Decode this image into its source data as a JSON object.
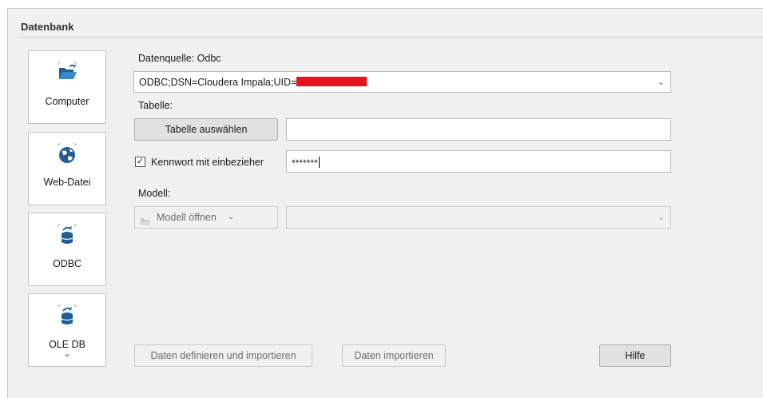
{
  "section": {
    "title": "Datenbank"
  },
  "sources": [
    {
      "label": "Computer",
      "icon": "folder-open-icon"
    },
    {
      "label": "Web-Datei",
      "icon": "globe-icon"
    },
    {
      "label": "ODBC",
      "icon": "database-refresh-icon"
    },
    {
      "label": "OLE DB",
      "icon": "database-refresh-icon",
      "chevron": "⌄"
    }
  ],
  "datasource": {
    "label": "Datenquelle: Odbc",
    "value": "ODBC;DSN=Cloudera Impala;UID=",
    "chevron": "⌄"
  },
  "table": {
    "label": "Tabelle:",
    "select_button": "Tabelle auswählen",
    "value": ""
  },
  "password": {
    "checkbox_label": "Kennwort mit einbezieher",
    "checked": true,
    "check_mark": "✓",
    "value": "*******"
  },
  "model": {
    "label": "Modell:",
    "open_button": "Modell öffnen",
    "open_button_chevron": "⌄",
    "value": "",
    "chevron": "⌄"
  },
  "footer": {
    "define_import": "Daten definieren und importieren",
    "import": "Daten importieren",
    "help": "Hilfe"
  },
  "colors": {
    "redaction": "#e8131b",
    "icon_blue": "#2a6ea8",
    "panel_bg": "#f0f0f0"
  }
}
